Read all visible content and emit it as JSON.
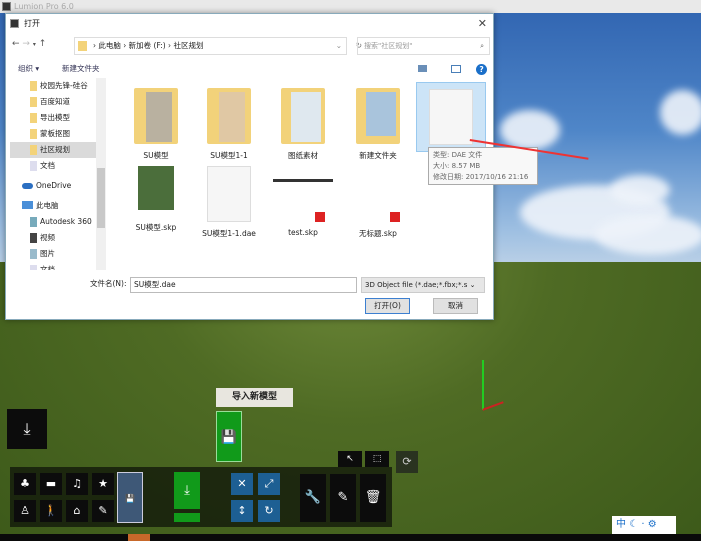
{
  "app": {
    "title": "Lumion Pro 6.0"
  },
  "dialog": {
    "title": "打开",
    "close": "✕",
    "breadcrumb": [
      "此电脑",
      "新加卷 (F:)",
      "社区规划"
    ],
    "search_placeholder": "搜索\"社区规划\"",
    "toolbar": {
      "organize": "组织 ▾",
      "new_folder": "新建文件夹"
    },
    "sidebar": [
      {
        "label": "校园先锋-硅谷"
      },
      {
        "label": "百度知道"
      },
      {
        "label": "导出模型"
      },
      {
        "label": "蒙板抠图"
      },
      {
        "label": "社区规划"
      },
      {
        "label": "文档"
      },
      {
        "label": "OneDrive"
      },
      {
        "label": "此电脑"
      },
      {
        "label": "Autodesk 360"
      },
      {
        "label": "视频"
      },
      {
        "label": "图片"
      },
      {
        "label": "文档"
      }
    ],
    "files": [
      {
        "name": "SU模型"
      },
      {
        "name": "SU模型1-1"
      },
      {
        "name": "图纸素材"
      },
      {
        "name": "新建文件夹"
      },
      {
        "name": ""
      },
      {
        "name": "SU模型.skp"
      },
      {
        "name": "SU模型1-1.dae"
      },
      {
        "name": "test.skp"
      },
      {
        "name": "无标题.skp"
      }
    ],
    "tooltip": {
      "type": "类型: DAE 文件",
      "size": "大小: 8.57 MB",
      "modified": "修改日期: 2017/10/16 21:16"
    },
    "filename_label": "文件名(N):",
    "filename_value": "SU模型.dae",
    "filetype": "3D Object file (*.dae;*.fbx;*.s ⌄",
    "open": "打开(O)",
    "cancel": "取消"
  },
  "lumion": {
    "import_tooltip": "导入新模型",
    "status": "中"
  }
}
